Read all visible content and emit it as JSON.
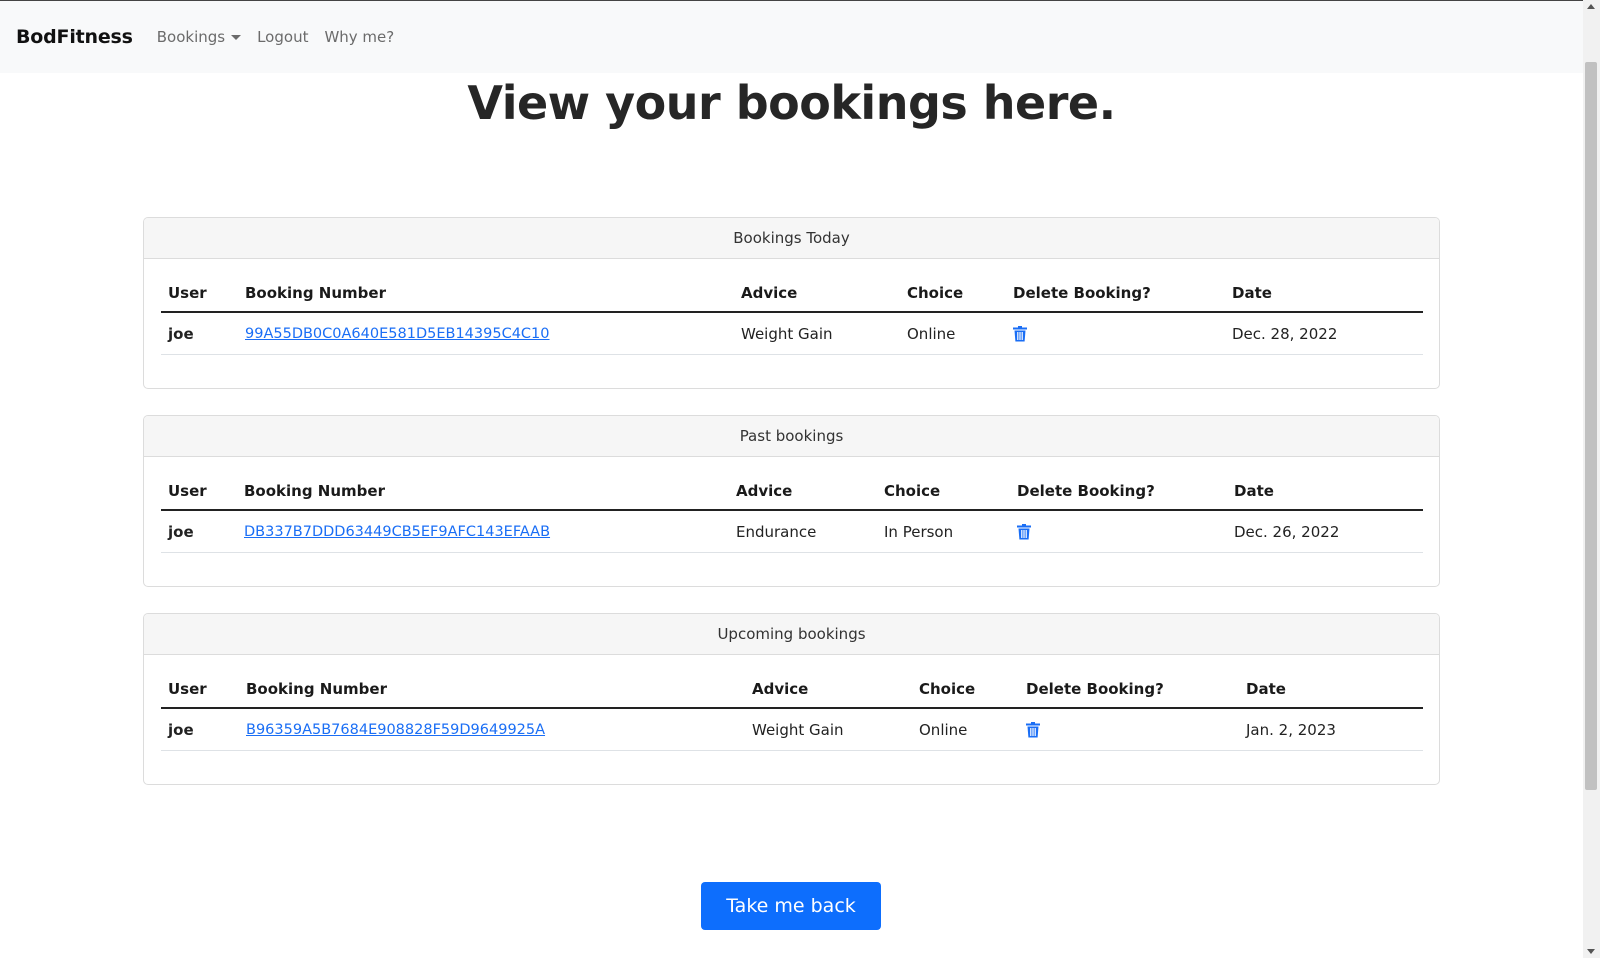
{
  "navbar": {
    "brand": "BodFitness",
    "links": [
      {
        "label": "Bookings",
        "dropdown": true
      },
      {
        "label": "Logout"
      },
      {
        "label": "Why me?"
      }
    ]
  },
  "page_title": "View your bookings here.",
  "columns": [
    "User",
    "Booking Number",
    "Advice",
    "Choice",
    "Delete Booking?",
    "Date"
  ],
  "sections": [
    {
      "title": "Bookings Today",
      "rows": [
        {
          "user": "joe",
          "booking_number": "99A55DB0C0A640E581D5EB14395C4C10",
          "advice": "Weight Gain",
          "choice": "Online",
          "delete_icon": "trash-icon",
          "date": "Dec. 28, 2022"
        }
      ]
    },
    {
      "title": "Past bookings",
      "rows": [
        {
          "user": "joe",
          "booking_number": "DB337B7DDD63449CB5EF9AFC143EFAAB",
          "advice": "Endurance",
          "choice": "In Person",
          "delete_icon": "trash-icon",
          "date": "Dec. 26, 2022"
        }
      ]
    },
    {
      "title": "Upcoming bookings",
      "rows": [
        {
          "user": "joe",
          "booking_number": "B96359A5B7684E908828F59D9649925A",
          "advice": "Weight Gain",
          "choice": "Online",
          "delete_icon": "trash-icon",
          "date": "Jan. 2, 2023"
        }
      ]
    }
  ],
  "back_button": "Take me back",
  "colors": {
    "primary": "#0d6efd",
    "link": "#1a6ef5",
    "navbar_bg": "#f8f9fa"
  }
}
